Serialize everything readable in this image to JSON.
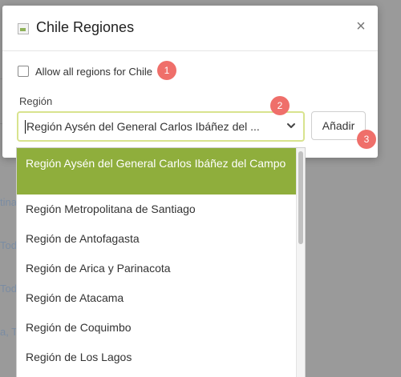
{
  "background": {
    "fragments": [
      "tina",
      "Tod",
      "Tod",
      "a, T"
    ]
  },
  "modal": {
    "title": "Chile Regiones",
    "close_icon": "×",
    "allow_all_label": "Allow all regions for Chile",
    "allow_all_checked": false,
    "region_label": "Región",
    "select_value": "Región Aysén del General Carlos Ibáñez del ...",
    "add_button": "Añadir"
  },
  "badges": [
    "1",
    "2",
    "3"
  ],
  "dropdown": {
    "options": [
      "Región Aysén del General Carlos Ibáñez del Campo",
      "Región Metropolitana de Santiago",
      "Región de Antofagasta",
      "Región de Arica y Parinacota",
      "Región de Atacama",
      "Región de Coquimbo",
      "Región de Los Lagos"
    ],
    "selected_index": 0
  },
  "colors": {
    "selected_option": "#8fae3c",
    "select_border": "#d8e38e",
    "badge": "#ef6f6a",
    "overlay": "#9a9a9a"
  },
  "icons": {
    "title": "image-placeholder-icon",
    "close": "close-icon",
    "select": "chevron-down-icon"
  }
}
